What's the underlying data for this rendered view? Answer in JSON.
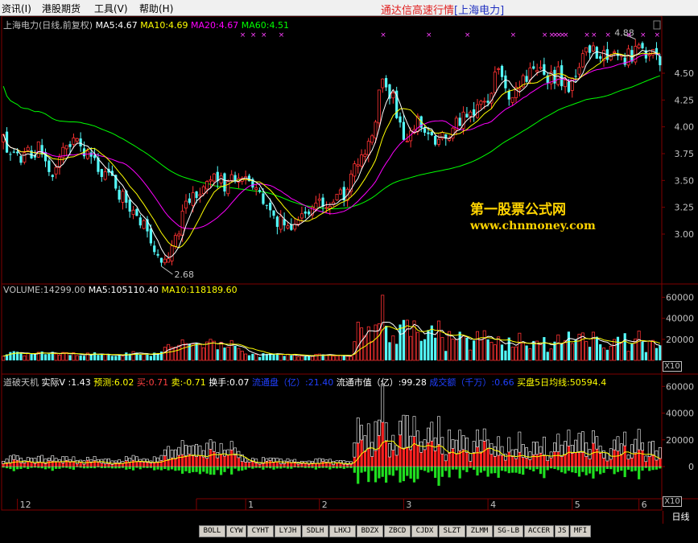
{
  "menu": {
    "items": [
      "资讯(I)",
      "港股期货",
      "工具(V)",
      "帮助(H)"
    ],
    "title": "通达信高速行情",
    "subtitle": "[上海电力]"
  },
  "price_panel": {
    "header": [
      {
        "text": "上海电力(日线,前复权)",
        "color": "#c0c0c0"
      },
      {
        "text": "MA5:4.67",
        "color": "#ffffff"
      },
      {
        "text": "MA10:4.69",
        "color": "#ffff00"
      },
      {
        "text": "MA20:4.67",
        "color": "#ff00ff"
      },
      {
        "text": "MA60:4.51",
        "color": "#00ff00"
      }
    ],
    "low_label": "2.68",
    "high_label": "4.88",
    "marker_glyph": "×",
    "axis_ticks": [
      "4.50",
      "4.25",
      "4.00",
      "3.75",
      "3.50",
      "3.25",
      "3.00"
    ]
  },
  "watermark": {
    "line1": "第一股票公式网",
    "line2": "www.chnmoney.com"
  },
  "volume_panel": {
    "header": [
      {
        "text": "VOLUME:14299.00",
        "color": "#c0c0c0"
      },
      {
        "text": "MA5:105110.40",
        "color": "#ffffff"
      },
      {
        "text": "MA10:118189.60",
        "color": "#ffff00"
      }
    ],
    "axis_ticks": [
      "60000",
      "40000",
      "20000"
    ],
    "unit": "X10"
  },
  "indicator_panel": {
    "header": [
      {
        "text": "道破天机",
        "color": "#c0c0c0"
      },
      {
        "text": "实际V :1.43",
        "color": "#ffffff"
      },
      {
        "text": "预测:6.02",
        "color": "#ffff00"
      },
      {
        "text": "买:0.71",
        "color": "#ff4040"
      },
      {
        "text": "卖:-0.71",
        "color": "#ffff00"
      },
      {
        "text": "换手:0.07",
        "color": "#ffffff"
      },
      {
        "text": "流通盘（亿）:21.40",
        "color": "#2040ff"
      },
      {
        "text": "流通市值（亿）:99.28",
        "color": "#ffffff"
      },
      {
        "text": "成交额（千万）:0.66",
        "color": "#2040ff"
      },
      {
        "text": "买盘5日均线:50594.4",
        "color": "#ffff00"
      }
    ],
    "axis_ticks": [
      "60000",
      "40000",
      "20000",
      "0"
    ],
    "unit": "X10"
  },
  "date_axis": {
    "months": [
      "12",
      "1",
      "2",
      "3",
      "4",
      "5",
      "6"
    ],
    "period_button": "日线"
  },
  "indicator_tabs": [
    "BOLL",
    "CYW",
    "CYHT",
    "LYJH",
    "SDLH",
    "LHXJ",
    "BDZX",
    "ZBCD",
    "CJDX",
    "SLZT",
    "ZLMM",
    "SG-LB",
    "ACCER",
    "JS",
    "MFI"
  ],
  "colors": {
    "up": "#ff3232",
    "down": "#54fcfc",
    "ma5": "#ffffff",
    "ma10": "#ffff00",
    "ma20": "#ff00ff",
    "ma60": "#00ff00",
    "grid": "#800000",
    "buy": "#ff2020",
    "sell": "#20e020"
  },
  "chart_data": {
    "type": "candlestick",
    "title": "上海电力(日线,前复权)",
    "ylim": [
      2.6,
      4.95
    ],
    "y_ticks": [
      3.0,
      3.25,
      3.5,
      3.75,
      4.0,
      4.25,
      4.5
    ],
    "low": 2.68,
    "high": 4.88,
    "close_path": [
      [
        0,
        3.85
      ],
      [
        5,
        3.72
      ],
      [
        10,
        3.78
      ],
      [
        14,
        3.55
      ],
      [
        18,
        3.9
      ],
      [
        22,
        3.8
      ],
      [
        27,
        3.6
      ],
      [
        32,
        3.45
      ],
      [
        36,
        3.25
      ],
      [
        40,
        3.05
      ],
      [
        44,
        2.78
      ],
      [
        46,
        2.72
      ],
      [
        49,
        2.98
      ],
      [
        53,
        3.35
      ],
      [
        56,
        3.4
      ],
      [
        60,
        3.52
      ],
      [
        64,
        3.45
      ],
      [
        68,
        3.58
      ],
      [
        72,
        3.48
      ],
      [
        75,
        3.3
      ],
      [
        78,
        3.1
      ],
      [
        82,
        3.1
      ],
      [
        86,
        3.22
      ],
      [
        90,
        3.25
      ],
      [
        94,
        3.3
      ],
      [
        98,
        3.42
      ],
      [
        102,
        3.75
      ],
      [
        105,
        3.95
      ],
      [
        108,
        4.45
      ],
      [
        111,
        4.25
      ],
      [
        114,
        3.9
      ],
      [
        118,
        4.05
      ],
      [
        122,
        3.88
      ],
      [
        126,
        3.92
      ],
      [
        130,
        4.05
      ],
      [
        134,
        4.15
      ],
      [
        138,
        4.25
      ],
      [
        141,
        4.55
      ],
      [
        144,
        4.28
      ],
      [
        147,
        4.38
      ],
      [
        151,
        4.55
      ],
      [
        155,
        4.42
      ],
      [
        158,
        4.5
      ],
      [
        161,
        4.3
      ],
      [
        164,
        4.6
      ],
      [
        167,
        4.72
      ],
      [
        170,
        4.6
      ],
      [
        173,
        4.75
      ],
      [
        176,
        4.62
      ],
      [
        180,
        4.68
      ],
      [
        184,
        4.7
      ],
      [
        187,
        4.65
      ]
    ],
    "candles_count": 188,
    "ma_current": {
      "MA5": 4.67,
      "MA10": 4.69,
      "MA20": 4.67,
      "MA60": 4.51
    },
    "volume": {
      "ylim": [
        0,
        65000
      ],
      "y_ticks": [
        20000,
        40000,
        60000
      ],
      "unit_multiplier": 10,
      "current": 14299.0,
      "ma5": 105110.4,
      "ma10": 118189.6,
      "peak_day": 108,
      "peak_value": 62000
    },
    "indicator": {
      "name": "道破天机",
      "ylim": [
        -35000,
        65000
      ],
      "y_ticks": [
        0,
        20000,
        40000,
        60000
      ],
      "buy_ma5": 50594.4
    },
    "month_starts": [
      {
        "label": "12",
        "day": 4
      },
      {
        "label": "1",
        "day": 69
      },
      {
        "label": "2",
        "day": 90
      },
      {
        "label": "3",
        "day": 114
      },
      {
        "label": "4",
        "day": 138
      },
      {
        "label": "5",
        "day": 162
      },
      {
        "label": "6",
        "day": 181
      }
    ],
    "marker_days": [
      68,
      71,
      74,
      79,
      108,
      121,
      132,
      145,
      154,
      156,
      157,
      158,
      159,
      160,
      166,
      168,
      172,
      178,
      182,
      186
    ]
  }
}
